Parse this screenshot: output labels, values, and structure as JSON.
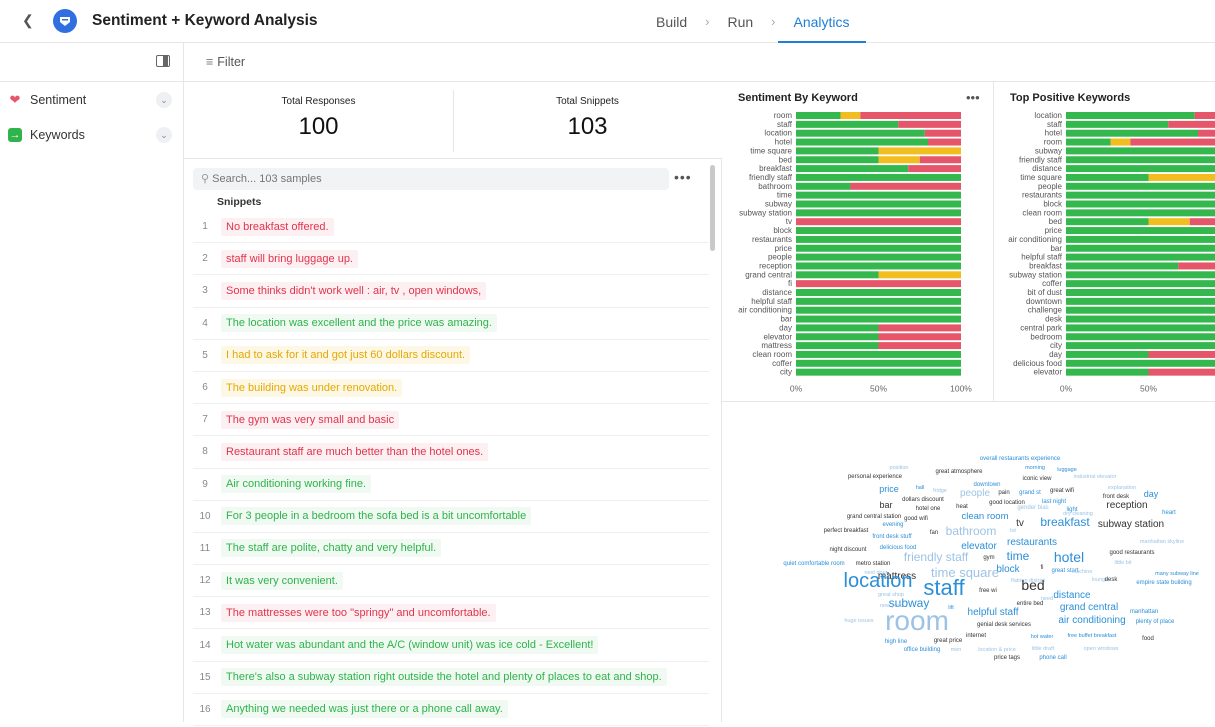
{
  "header": {
    "title": "Sentiment + Keyword Analysis",
    "tabs": [
      {
        "label": "Build"
      },
      {
        "label": "Run"
      },
      {
        "label": "Analytics"
      }
    ]
  },
  "sidebar": {
    "items": [
      {
        "label": "Sentiment"
      },
      {
        "label": "Keywords"
      }
    ]
  },
  "filter": {
    "label": "Filter"
  },
  "stats": {
    "total_responses": {
      "label": "Total Responses",
      "value": "100"
    },
    "total_snippets": {
      "label": "Total Snippets",
      "value": "103"
    }
  },
  "snippets": {
    "search_placeholder": "Search... 103 samples",
    "column_header": "Snippets",
    "rows": [
      {
        "num": "1",
        "text": "No breakfast offered.",
        "sentiment": "neg"
      },
      {
        "num": "2",
        "text": "staff will bring luggage up.",
        "sentiment": "neg"
      },
      {
        "num": "3",
        "text": "Some thinks didn't work well : air, tv , open windows,",
        "sentiment": "neg"
      },
      {
        "num": "4",
        "text": "The location was excellent and the price was amazing.",
        "sentiment": "pos"
      },
      {
        "num": "5",
        "text": "I had to ask for it and got just 60 dollars discount.",
        "sentiment": "neu"
      },
      {
        "num": "6",
        "text": "The building was under renovation.",
        "sentiment": "neu"
      },
      {
        "num": "7",
        "text": "The gym was very small and basic",
        "sentiment": "neg"
      },
      {
        "num": "8",
        "text": "Restaurant staff are much better than the hotel ones.",
        "sentiment": "neg"
      },
      {
        "num": "9",
        "text": "Air conditioning working fine.",
        "sentiment": "pos"
      },
      {
        "num": "10",
        "text": "For 3 people in a bedroom the sofa bed is a bit uncomfortable",
        "sentiment": "pos"
      },
      {
        "num": "11",
        "text": "The staff are polite, chatty and very helpful.",
        "sentiment": "pos"
      },
      {
        "num": "12",
        "text": "It was very convenient.",
        "sentiment": "pos"
      },
      {
        "num": "13",
        "text": "The mattresses were too \"springy\" and uncomfortable.",
        "sentiment": "neg"
      },
      {
        "num": "14",
        "text": "Hot water was abundant and the A/C (window unit) was ice cold - Excellent!",
        "sentiment": "pos"
      },
      {
        "num": "15",
        "text": "There's also a subway station right outside the hotel and plenty of places to eat and shop.",
        "sentiment": "pos"
      },
      {
        "num": "16",
        "text": "Anything we needed was just there or a phone call away.",
        "sentiment": "pos"
      }
    ]
  },
  "colors": {
    "positive": "#34b84e",
    "neutral": "#f1bd1f",
    "negative": "#e5566a",
    "accent": "#1d7fd6"
  },
  "chart_data": [
    {
      "type": "bar",
      "title": "Sentiment By Keyword",
      "orientation": "horizontal-stacked-percent",
      "x_ticks": [
        "0%",
        "50%",
        "100%"
      ],
      "categories": [
        "room",
        "staff",
        "location",
        "hotel",
        "time square",
        "bed",
        "breakfast",
        "friendly staff",
        "bathroom",
        "time",
        "subway",
        "subway station",
        "tv",
        "block",
        "restaurants",
        "price",
        "people",
        "reception",
        "grand central",
        "fi",
        "distance",
        "helpful staff",
        "air conditioning",
        "bar",
        "day",
        "elevator",
        "mattress",
        "clean room",
        "coffer",
        "city"
      ],
      "series": [
        {
          "name": "positive",
          "values": [
            27,
            62,
            78,
            80,
            50,
            50,
            68,
            100,
            33,
            100,
            100,
            100,
            0,
            100,
            100,
            100,
            100,
            100,
            50,
            0,
            100,
            100,
            100,
            100,
            50,
            50,
            50,
            100,
            100,
            100
          ]
        },
        {
          "name": "neutral",
          "values": [
            12,
            0,
            0,
            0,
            50,
            25,
            0,
            0,
            0,
            0,
            0,
            0,
            0,
            0,
            0,
            0,
            0,
            0,
            50,
            0,
            0,
            0,
            0,
            0,
            0,
            0,
            0,
            0,
            0,
            0
          ]
        },
        {
          "name": "negative",
          "values": [
            61,
            38,
            22,
            20,
            0,
            25,
            32,
            0,
            67,
            0,
            0,
            0,
            100,
            0,
            0,
            0,
            0,
            0,
            0,
            100,
            0,
            0,
            0,
            0,
            50,
            50,
            50,
            0,
            0,
            0
          ]
        }
      ]
    },
    {
      "type": "bar",
      "title": "Top Positive Keywords",
      "orientation": "horizontal-stacked-percent",
      "x_ticks": [
        "0%",
        "50%"
      ],
      "categories": [
        "location",
        "staff",
        "hotel",
        "room",
        "subway",
        "friendly staff",
        "distance",
        "time square",
        "people",
        "restaurants",
        "block",
        "clean room",
        "bed",
        "price",
        "air conditioning",
        "bar",
        "helpful staff",
        "breakfast",
        "subway station",
        "coffer",
        "bit of dust",
        "downtown",
        "challenge",
        "desk",
        "central park",
        "bedroom",
        "city",
        "day",
        "delicious food",
        "elevator"
      ],
      "series": [
        {
          "name": "positive",
          "values": [
            78,
            62,
            80,
            27,
            100,
            100,
            100,
            50,
            100,
            100,
            100,
            100,
            50,
            100,
            100,
            100,
            100,
            68,
            100,
            100,
            100,
            100,
            100,
            100,
            100,
            100,
            100,
            50,
            100,
            50
          ]
        },
        {
          "name": "neutral",
          "values": [
            0,
            0,
            0,
            12,
            0,
            0,
            0,
            50,
            0,
            0,
            0,
            0,
            25,
            0,
            0,
            0,
            0,
            0,
            0,
            0,
            0,
            0,
            0,
            0,
            0,
            0,
            0,
            0,
            0,
            0
          ]
        },
        {
          "name": "negative",
          "values": [
            22,
            38,
            20,
            61,
            0,
            0,
            0,
            0,
            0,
            0,
            0,
            0,
            25,
            0,
            0,
            0,
            0,
            32,
            0,
            0,
            0,
            0,
            0,
            0,
            0,
            0,
            0,
            50,
            0,
            50
          ]
        }
      ]
    }
  ],
  "wordcloud": {
    "words": [
      {
        "t": "overall restaurants experience",
        "s": 6,
        "c": "#2b8fd8"
      },
      {
        "t": "position",
        "s": 5.5,
        "c": "#9cc3e6"
      },
      {
        "t": "morning",
        "s": 5.5,
        "c": "#2b8fd8"
      },
      {
        "t": "luggage",
        "s": 5.5,
        "c": "#2b8fd8"
      },
      {
        "t": "great atmosphere",
        "s": 6,
        "c": "#333"
      },
      {
        "t": "personal experience",
        "s": 6,
        "c": "#333"
      },
      {
        "t": "iconic view",
        "s": 6,
        "c": "#333"
      },
      {
        "t": "industrial elevator",
        "s": 5.5,
        "c": "#9cc3e6"
      },
      {
        "t": "downtown",
        "s": 6,
        "c": "#2b8fd8"
      },
      {
        "t": "price",
        "s": 9,
        "c": "#2b8fd8"
      },
      {
        "t": "hall",
        "s": 5.5,
        "c": "#2b8fd8"
      },
      {
        "t": "fridge",
        "s": 5.5,
        "c": "#9cc3e6"
      },
      {
        "t": "pain",
        "s": 6,
        "c": "#333"
      },
      {
        "t": "grand st",
        "s": 6,
        "c": "#2b8fd8"
      },
      {
        "t": "great wifi",
        "s": 6,
        "c": "#333"
      },
      {
        "t": "explanation",
        "s": 5.5,
        "c": "#9cc3e6"
      },
      {
        "t": "front desk",
        "s": 6,
        "c": "#333"
      },
      {
        "t": "dollars discount",
        "s": 6,
        "c": "#333"
      },
      {
        "t": "good location",
        "s": 6,
        "c": "#333"
      },
      {
        "t": "last night",
        "s": 6,
        "c": "#2b8fd8"
      },
      {
        "t": "day",
        "s": 9,
        "c": "#2b8fd8"
      },
      {
        "t": "bar",
        "s": 9,
        "c": "#333"
      },
      {
        "t": "heat",
        "s": 6,
        "c": "#333"
      },
      {
        "t": "hotel one",
        "s": 6,
        "c": "#333"
      },
      {
        "t": "gender bias",
        "s": 6,
        "c": "#9cc3e6"
      },
      {
        "t": "light",
        "s": 6,
        "c": "#2b8fd8"
      },
      {
        "t": "reception",
        "s": 10,
        "c": "#333"
      },
      {
        "t": "grand central station",
        "s": 6,
        "c": "#333"
      },
      {
        "t": "good wifi",
        "s": 6,
        "c": "#333"
      },
      {
        "t": "clean room",
        "s": 9.5,
        "c": "#2b8fd8"
      },
      {
        "t": "heart",
        "s": 6,
        "c": "#2b8fd8"
      },
      {
        "t": "evening",
        "s": 6,
        "c": "#2b8fd8"
      },
      {
        "t": "people",
        "s": 10,
        "c": "#9cc3e6"
      },
      {
        "t": "tv",
        "s": 10,
        "c": "#333"
      },
      {
        "t": "breakfast",
        "s": 12,
        "c": "#2b8fd8"
      },
      {
        "t": "subway station",
        "s": 10,
        "c": "#333"
      },
      {
        "t": "perfect breakfast",
        "s": 6,
        "c": "#333"
      },
      {
        "t": "fan",
        "s": 6,
        "c": "#333"
      },
      {
        "t": "bathroom",
        "s": 12,
        "c": "#9cc3e6"
      },
      {
        "t": "lot",
        "s": 5.5,
        "c": "#9cc3e6"
      },
      {
        "t": "front desk stuff",
        "s": 6,
        "c": "#2b8fd8"
      },
      {
        "t": "restaurants",
        "s": 10,
        "c": "#2b8fd8"
      },
      {
        "t": "dry cleaning",
        "s": 5.5,
        "c": "#9cc3e6"
      },
      {
        "t": "manhattan skyline",
        "s": 5.5,
        "c": "#9cc3e6"
      },
      {
        "t": "night discount",
        "s": 6,
        "c": "#333"
      },
      {
        "t": "delicious food",
        "s": 6,
        "c": "#2b8fd8"
      },
      {
        "t": "elevator",
        "s": 10,
        "c": "#2b8fd8"
      },
      {
        "t": "time",
        "s": 12,
        "c": "#2b8fd8"
      },
      {
        "t": "hotel",
        "s": 14,
        "c": "#2b8fd8"
      },
      {
        "t": "good restaurants",
        "s": 6,
        "c": "#333"
      },
      {
        "t": "friendly staff",
        "s": 12,
        "c": "#9cc3e6"
      },
      {
        "t": "gym",
        "s": 6,
        "c": "#333"
      },
      {
        "t": "little bit",
        "s": 5.5,
        "c": "#9cc3e6"
      },
      {
        "t": "quiet comfortable room",
        "s": 6,
        "c": "#2b8fd8"
      },
      {
        "t": "metro station",
        "s": 6,
        "c": "#333"
      },
      {
        "t": "block",
        "s": 10,
        "c": "#2b8fd8"
      },
      {
        "t": "fi",
        "s": 6,
        "c": "#333"
      },
      {
        "t": "great start",
        "s": 6,
        "c": "#2b8fd8"
      },
      {
        "t": "next door",
        "s": 5.5,
        "c": "#9cc3e6"
      },
      {
        "t": "mattress",
        "s": 10,
        "c": "#333"
      },
      {
        "t": "time square",
        "s": 13,
        "c": "#9cc3e6"
      },
      {
        "t": "machine",
        "s": 5.5,
        "c": "#9cc3e6"
      },
      {
        "t": "many subway line",
        "s": 5.5,
        "c": "#2b8fd8"
      },
      {
        "t": "flatiron district",
        "s": 5.5,
        "c": "#9cc3e6"
      },
      {
        "t": "lounge",
        "s": 5.5,
        "c": "#9cc3e6"
      },
      {
        "t": "desk",
        "s": 6,
        "c": "#333"
      },
      {
        "t": "empire state building",
        "s": 6,
        "c": "#2b8fd8"
      },
      {
        "t": "location",
        "s": 20,
        "c": "#2b8fd8"
      },
      {
        "t": "staff",
        "s": 22,
        "c": "#2b8fd8"
      },
      {
        "t": "free wi",
        "s": 6,
        "c": "#333"
      },
      {
        "t": "bed",
        "s": 14,
        "c": "#333"
      },
      {
        "t": "distance",
        "s": 10,
        "c": "#2b8fd8"
      },
      {
        "t": "great shop",
        "s": 5.5,
        "c": "#9cc3e6"
      },
      {
        "t": "need",
        "s": 5.5,
        "c": "#9cc3e6"
      },
      {
        "t": "subway",
        "s": 12,
        "c": "#2b8fd8"
      },
      {
        "t": "new york",
        "s": 5.5,
        "c": "#9cc3e6"
      },
      {
        "t": "entire bed",
        "s": 6,
        "c": "#333"
      },
      {
        "t": "grand central",
        "s": 10,
        "c": "#2b8fd8"
      },
      {
        "t": "manhattan",
        "s": 6,
        "c": "#2b8fd8"
      },
      {
        "t": "lift",
        "s": 5.5,
        "c": "#2b8fd8"
      },
      {
        "t": "huge issues",
        "s": 5.5,
        "c": "#9cc3e6"
      },
      {
        "t": "room",
        "s": 28,
        "c": "#9cc3e6"
      },
      {
        "t": "helpful staff",
        "s": 10,
        "c": "#2b8fd8"
      },
      {
        "t": "genial desk services",
        "s": 6,
        "c": "#333"
      },
      {
        "t": "air conditioning",
        "s": 10,
        "c": "#2b8fd8"
      },
      {
        "t": "plenty of place",
        "s": 6,
        "c": "#2b8fd8"
      },
      {
        "t": "internet",
        "s": 6,
        "c": "#333"
      },
      {
        "t": "hot water",
        "s": 5.5,
        "c": "#2b8fd8"
      },
      {
        "t": "free buffet breakfast",
        "s": 5.5,
        "c": "#2b8fd8"
      },
      {
        "t": "food",
        "s": 6,
        "c": "#333"
      },
      {
        "t": "high line",
        "s": 6,
        "c": "#2b8fd8"
      },
      {
        "t": "great price",
        "s": 6,
        "c": "#333"
      },
      {
        "t": "office building",
        "s": 6,
        "c": "#2b8fd8"
      },
      {
        "t": "men",
        "s": 5.5,
        "c": "#9cc3e6"
      },
      {
        "t": "location & price",
        "s": 5.5,
        "c": "#9cc3e6"
      },
      {
        "t": "little draft",
        "s": 5.5,
        "c": "#9cc3e6"
      },
      {
        "t": "open windows",
        "s": 5.5,
        "c": "#9cc3e6"
      },
      {
        "t": "price tags",
        "s": 6,
        "c": "#333"
      },
      {
        "t": "phone call",
        "s": 6,
        "c": "#2b8fd8"
      }
    ]
  }
}
